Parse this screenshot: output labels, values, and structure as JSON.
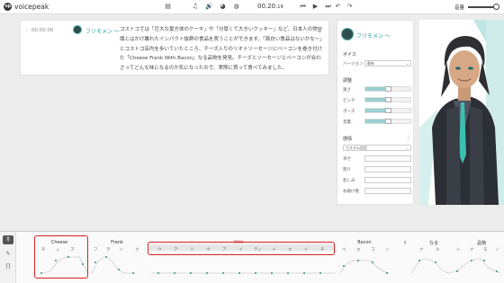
{
  "app": {
    "name": "voicepeak",
    "logo_mark": "vp"
  },
  "toolbar": {
    "timecode_main": "00.20.",
    "timecode_frac": "19",
    "volume_label": "音量",
    "icons": [
      "file-icon",
      "music-icon",
      "speaker-icon",
      "face-icon",
      "skip-start-icon",
      "play-icon",
      "skip-end-icon",
      "undo-icon",
      "redo-icon"
    ]
  },
  "script_block": {
    "time": "00.00.00",
    "speaker": "フリモメン ～",
    "text": "コストコでは「巨大な夏方体のケーキ」や「分厚くて大きいクッキー」など、日本人の常識とはかけ離れたインパクト抜群の食品を買うことができます。「面白い食品はないかな〜」とコストコ店内を歩いていたところ、チーズ入りのリオナソーセージにベーコンを巻き付けた「Cheese Frank With Bacon」なる品物を発見。チーズとソーセージとベーコンが合わさってどんな味になるのか気になったので、実際に買って食べてみました。"
  },
  "right_panel": {
    "speaker_name": "フリモメン ～",
    "voice_section": "ボイス",
    "version_label": "バージョン",
    "version_value": "最新",
    "adjust_section": "調整",
    "sliders": [
      {
        "label": "速さ",
        "value": 0.5
      },
      {
        "label": "ピッチ",
        "value": 0.5
      },
      {
        "label": "ポーズ",
        "value": 0.5
      },
      {
        "label": "音量",
        "value": 0.5
      }
    ],
    "emotion_section": "感情",
    "emotion_preset": "カスタム設定",
    "emotions": [
      "幸せ",
      "怒り",
      "悲しみ",
      "お助け者"
    ]
  },
  "timeline": {
    "words": [
      {
        "label": "Cheese",
        "accent": false
      },
      {
        "label": "Frank",
        "accent": false
      },
      {
        "label": "With",
        "accent": true
      },
      {
        "label": "Bacon",
        "accent": false
      },
      {
        "label": "↓",
        "accent": false
      },
      {
        "label": "なる",
        "accent": false
      },
      {
        "label": "品物",
        "accent": false
      }
    ],
    "mora": {
      "cheese": [
        "チ",
        "ィ",
        "ズ"
      ],
      "frank": [
        "フ",
        "ラ",
        "ン",
        "ク"
      ],
      "with": [
        "ウ",
        "ア",
        "リ",
        "ウ",
        "ア",
        "イ",
        "ティ",
        "イ",
        "エ",
        "イ",
        "チ"
      ],
      "bacon": [
        "ベ",
        "エ",
        "コ",
        "ン"
      ],
      "naru": [
        "ナ",
        "ル"
      ],
      "shinamono": [
        "シ",
        "ナ",
        "モ",
        "ノ"
      ]
    }
  }
}
